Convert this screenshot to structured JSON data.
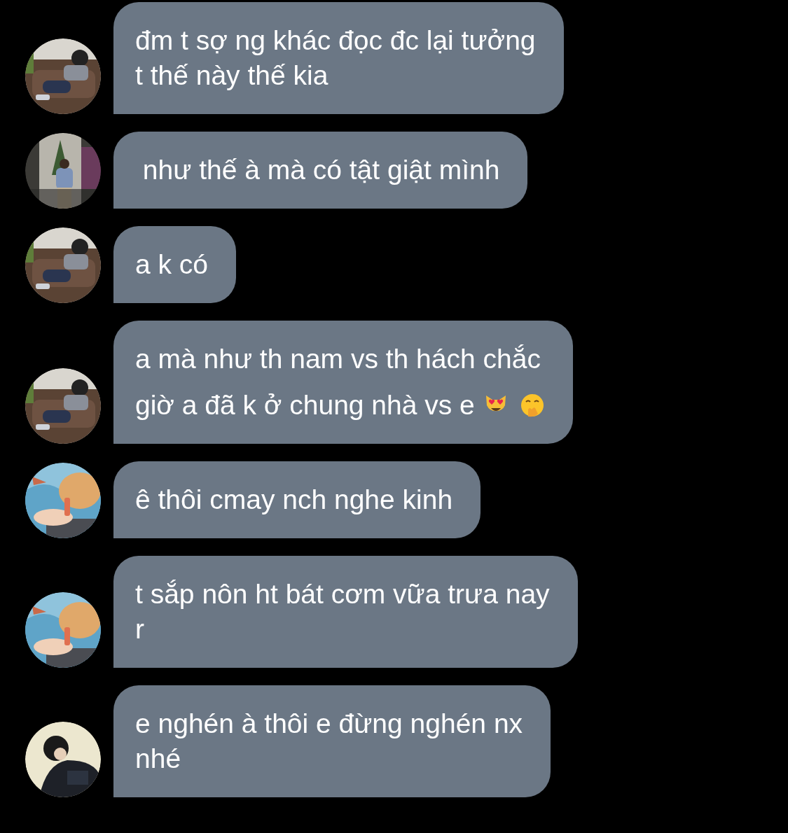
{
  "messages": [
    {
      "avatar": {
        "kind": "picture"
      },
      "lines": [
        "đm t sợ ng khác đọc đc lại tưởng",
        "t thế này thế kia"
      ]
    },
    {
      "avatar": {
        "kind": "picture"
      },
      "lines": [
        " như thế à mà có tật giật mình"
      ]
    },
    {
      "avatar": {
        "kind": "picture"
      },
      "lines": [
        "a k có"
      ]
    },
    {
      "avatar": {
        "kind": "picture"
      },
      "lines": [
        "a mà như th nam vs th hách chắc",
        "giờ a đã k ở chung nhà vs e"
      ],
      "emojis": [
        {
          "kind": "cat_heart_eyes"
        },
        {
          "kind": "hand_over_mouth"
        }
      ]
    },
    {
      "avatar": {
        "kind": "picture"
      },
      "lines": [
        "ê thôi cmay nch nghe kinh"
      ]
    },
    {
      "avatar": {
        "kind": "picture"
      },
      "lines": [
        "t sắp nôn ht bát cơm vữa trưa nay",
        "r"
      ]
    },
    {
      "avatar": {
        "kind": "picture"
      },
      "lines": [
        "e nghén à thôi e đừng nghén nx",
        "nhé"
      ]
    }
  ]
}
